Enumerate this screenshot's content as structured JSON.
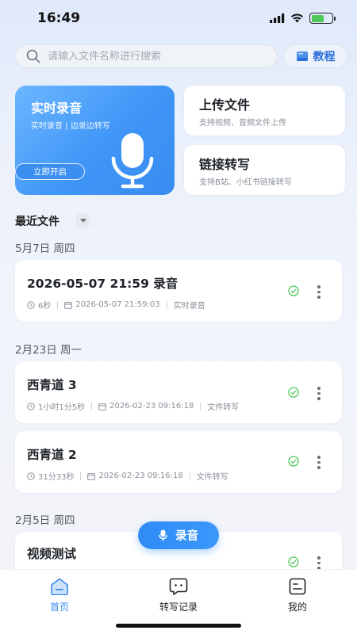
{
  "status_bar": {
    "time": "16:49"
  },
  "search": {
    "placeholder": "请输入文件名称进行搜索",
    "value": ""
  },
  "tutorial": {
    "label": "教程"
  },
  "realtime_card": {
    "title": "实时录音",
    "subtitle": "实时录音 | 边录边转写",
    "button": "立即开启"
  },
  "upload_card": {
    "title": "上传文件",
    "subtitle": "支持视频、音频文件上传"
  },
  "link_card": {
    "title": "链接转写",
    "subtitle": "支持B站、小红书链接转写"
  },
  "recent": {
    "label": "最近文件"
  },
  "groups": [
    {
      "date": "5月7日 周四"
    },
    {
      "date": "2月23日 周一"
    },
    {
      "date": "2月5日 周四"
    }
  ],
  "files": [
    {
      "name": "2026-05-07 21:59 录音",
      "duration": "6秒",
      "datetime": "2026-05-07 21:59:03",
      "type": "实时录音"
    },
    {
      "name": "西青道 3",
      "duration": "1小时1分5秒",
      "datetime": "2026-02-23 09:16:18",
      "type": "文件转写"
    },
    {
      "name": "西青道 2",
      "duration": "31分33秒",
      "datetime": "2026-02-23 09:16:18",
      "type": "文件转写"
    },
    {
      "name": "视频测试"
    }
  ],
  "fab": {
    "label": "录音"
  },
  "tabs": [
    {
      "label": "首页",
      "icon": "home-icon",
      "active": true
    },
    {
      "label": "转写记录",
      "icon": "chat-icon",
      "active": false
    },
    {
      "label": "我的",
      "icon": "profile-icon",
      "active": false
    }
  ],
  "colors": {
    "accent": "#3a8af0",
    "success": "#4cc75a",
    "card_blue": "#4a9ef8"
  }
}
